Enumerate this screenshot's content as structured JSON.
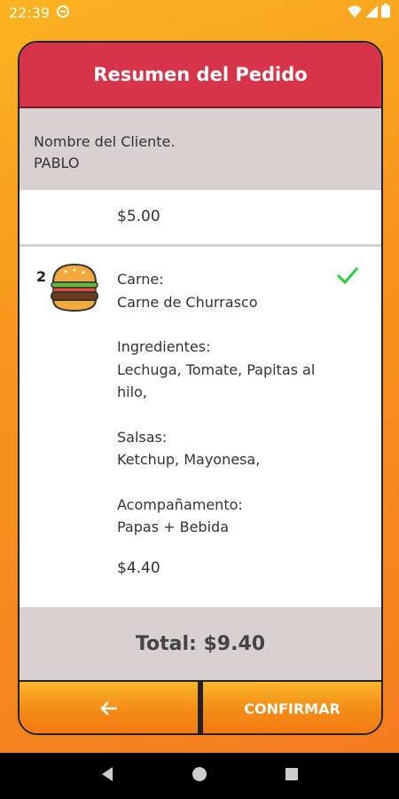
{
  "status_bar": {
    "time": "22:39",
    "icons": [
      "sync-icon",
      "wifi-icon",
      "signal-icon",
      "battery-icon"
    ]
  },
  "header": {
    "title": "Resumen del Pedido"
  },
  "client": {
    "label": "Nombre del Cliente.",
    "name": "PABLO"
  },
  "first_item": {
    "price": "$5.00"
  },
  "order_item": {
    "quantity": "2",
    "icon": "burger-icon",
    "meat_label": "Carne:",
    "meat_value": "Carne de Churrasco",
    "ingredients_label": "Ingredientes:",
    "ingredients_value": "Lechuga, Tomate, Papitas al hilo,",
    "sauces_label": "Salsas:",
    "sauces_value": "Ketchup, Mayonesa,",
    "side_label": "Acompañamento:",
    "side_value": "Papas + Bebida",
    "price": "$4.40",
    "selected": true
  },
  "total": {
    "text": "Total: $9.40"
  },
  "buttons": {
    "back_icon": "arrow-left-icon",
    "confirm_label": "CONFIRMAR"
  },
  "nav_bar": {
    "icons": [
      "back-triangle-icon",
      "home-circle-icon",
      "recents-square-icon"
    ]
  },
  "colors": {
    "header": "#d7344a",
    "accent_orange": "#f7941d",
    "panel_gray": "#d8d1cf",
    "check_green": "#2ecc40"
  }
}
